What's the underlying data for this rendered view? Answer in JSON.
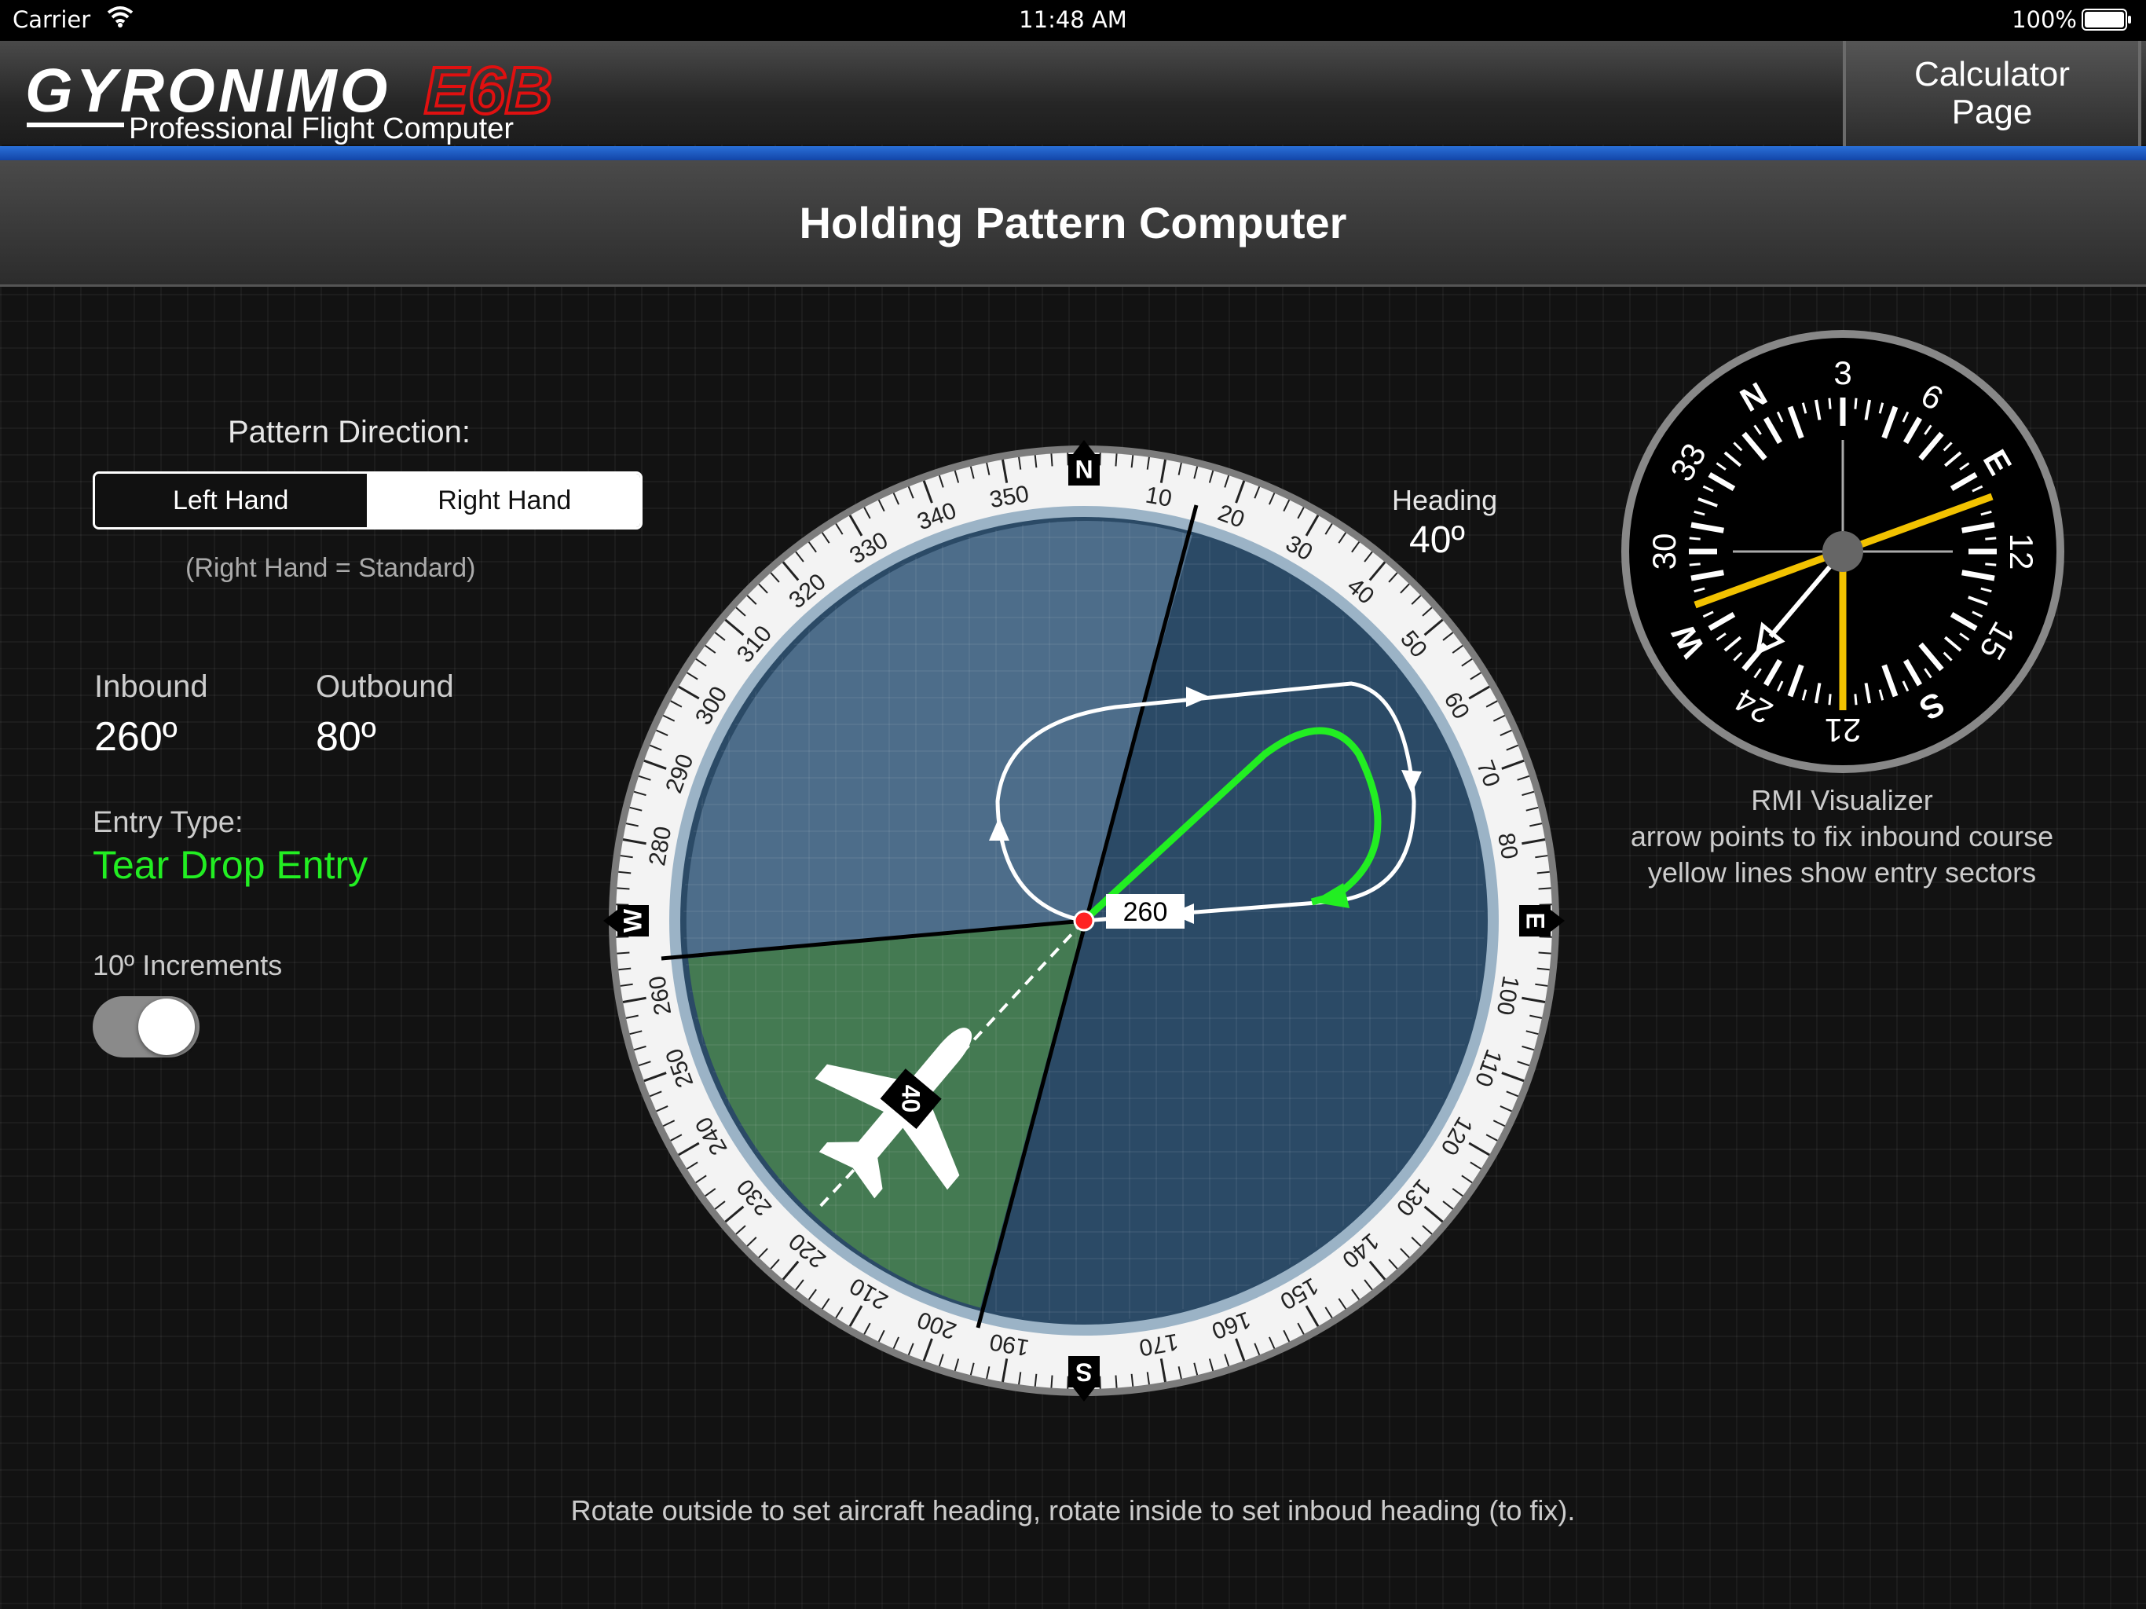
{
  "status_bar": {
    "carrier": "Carrier",
    "time": "11:48 AM",
    "battery": "100%"
  },
  "header": {
    "logo_name": "GYRONIMO",
    "logo_model": "E6B",
    "logo_subtitle": "Professional Flight Computer",
    "calc_button_line1": "Calculator",
    "calc_button_line2": "Page"
  },
  "page_title": "Holding Pattern Computer",
  "pattern_direction": {
    "label": "Pattern Direction:",
    "options": [
      "Left Hand",
      "Right Hand"
    ],
    "selected": "Right Hand",
    "note": "(Right Hand = Standard)"
  },
  "inbound": {
    "label": "Inbound",
    "value": "260º"
  },
  "outbound": {
    "label": "Outbound",
    "value": "80º"
  },
  "entry": {
    "label": "Entry Type:",
    "value": "Tear Drop Entry"
  },
  "increments": {
    "label": "10º Increments",
    "enabled": true
  },
  "heading": {
    "label": "Heading",
    "value": "40º"
  },
  "compass": {
    "cardinals": [
      "N",
      "E",
      "S",
      "W"
    ],
    "degree_labels": [
      "10",
      "20",
      "30",
      "40",
      "50",
      "60",
      "70",
      "80",
      "100",
      "110",
      "120",
      "130",
      "140",
      "150",
      "160",
      "170",
      "190",
      "200",
      "210",
      "220",
      "230",
      "240",
      "250",
      "260",
      "280",
      "290",
      "300",
      "310",
      "320",
      "330",
      "340",
      "350"
    ],
    "fix_label": "260",
    "aircraft_label": "40",
    "aircraft_heading_deg": 40,
    "inbound_course_deg": 260
  },
  "rmi": {
    "labels": [
      "N",
      "3",
      "6",
      "E",
      "12",
      "15",
      "S",
      "21",
      "24",
      "W",
      "30",
      "33"
    ],
    "caption_title": "RMI Visualizer",
    "caption_line1": "arrow points to fix inbound course",
    "caption_line2": "yellow lines show entry sectors"
  },
  "instructions": "Rotate outside to set aircraft heading, rotate inside to set inboud heading (to fix).",
  "colors": {
    "accent_blue": "#1a5cc8",
    "entry_green": "#22ee22",
    "rmi_yellow": "#f2c200",
    "logo_red": "#e01010"
  }
}
